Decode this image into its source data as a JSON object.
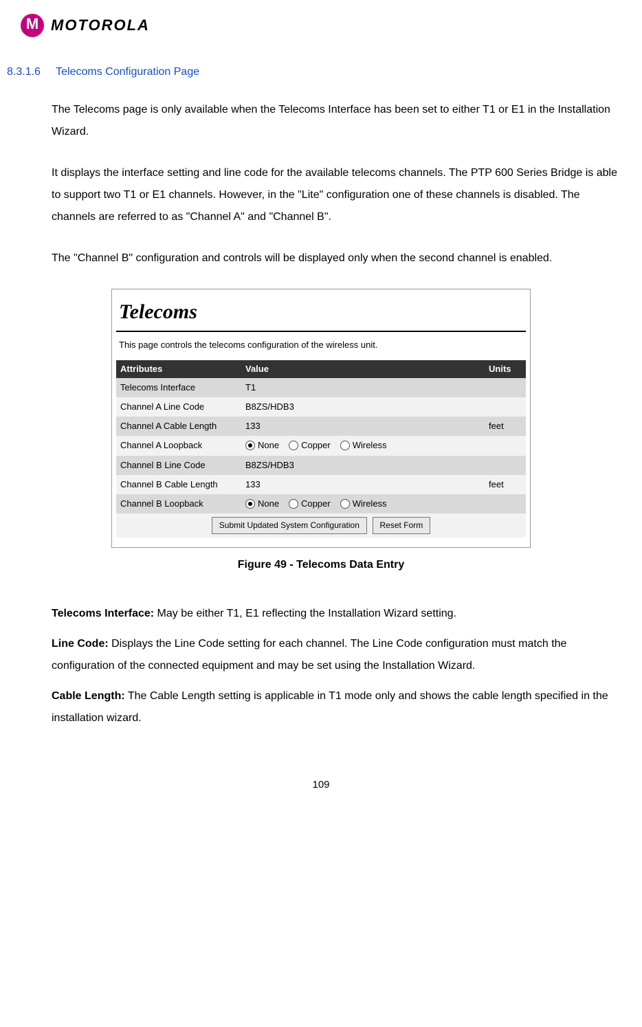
{
  "logo": {
    "wordmark": "MOTOROLA"
  },
  "section": {
    "num": "8.3.1.6",
    "title": "Telecoms Configuration Page"
  },
  "paragraphs": {
    "p1": "The Telecoms page is only available when the Telecoms Interface has been set to either T1 or E1 in the Installation Wizard.",
    "p2": "It displays the interface setting and line code for the available telecoms channels. The PTP 600 Series Bridge is able to support two T1 or E1 channels. However, in the \"Lite\" configuration one of these channels is disabled. The channels are referred to as \"Channel A\" and \"Channel B\".",
    "p3": "The \"Channel B\" configuration and controls will be displayed only when the second channel is enabled."
  },
  "figure": {
    "title": "Telecoms",
    "desc": "This page controls the telecoms configuration of the wireless unit.",
    "headers": {
      "attr": "Attributes",
      "val": "Value",
      "units": "Units"
    },
    "rows": {
      "r0": {
        "attr": "Telecoms Interface",
        "val": "T1",
        "units": ""
      },
      "r1": {
        "attr": "Channel A Line Code",
        "val": "B8ZS/HDB3",
        "units": ""
      },
      "r2": {
        "attr": "Channel A Cable Length",
        "val": "133",
        "units": "feet"
      },
      "r3": {
        "attr": "Channel A Loopback",
        "opts": {
          "a": "None",
          "b": "Copper",
          "c": "Wireless"
        },
        "sel": "a",
        "units": ""
      },
      "r4": {
        "attr": "Channel B Line Code",
        "val": "B8ZS/HDB3",
        "units": ""
      },
      "r5": {
        "attr": "Channel B Cable Length",
        "val": "133",
        "units": "feet"
      },
      "r6": {
        "attr": "Channel B Loopback",
        "opts": {
          "a": "None",
          "b": "Copper",
          "c": "Wireless"
        },
        "sel": "a",
        "units": ""
      }
    },
    "buttons": {
      "submit": "Submit Updated System Configuration",
      "reset": "Reset Form"
    },
    "caption": "Figure 49 - Telecoms Data Entry"
  },
  "defs": {
    "d1": {
      "term": "Telecoms Interface:",
      "text": " May be either T1, E1 reflecting the Installation Wizard setting."
    },
    "d2": {
      "term": "Line Code:",
      "text": " Displays the Line Code setting for each channel. The Line Code configuration must match the configuration of the connected equipment and may be set using the Installation Wizard."
    },
    "d3": {
      "term": "Cable Length:",
      "text": " The Cable Length setting is applicable in T1 mode only and shows the cable length specified in the installation wizard."
    }
  },
  "pagenum": "109"
}
